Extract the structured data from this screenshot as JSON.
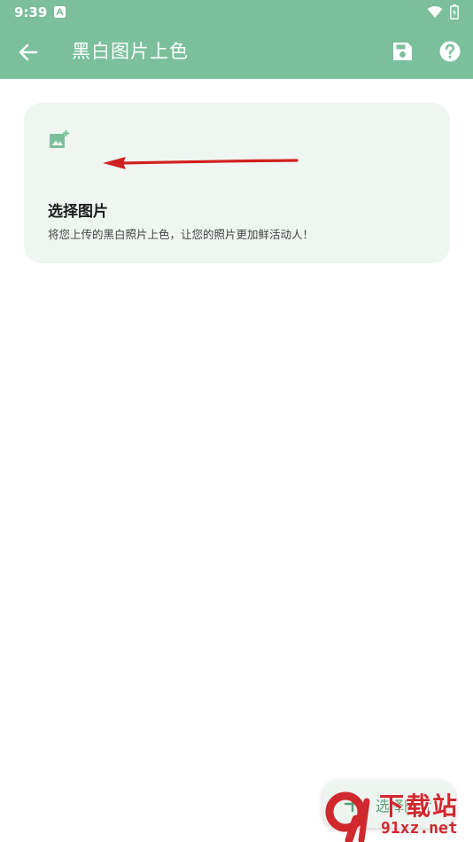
{
  "status_bar": {
    "time": "9:39"
  },
  "toolbar": {
    "title": "黑白图片上色"
  },
  "card": {
    "title": "选择图片",
    "description": "将您上传的黑白照片上色，让您的照片更加鲜活动人！"
  },
  "fab": {
    "label": "选择图片"
  },
  "watermark": {
    "brand": "下载站",
    "url": "91xz.net"
  },
  "colors": {
    "header": "#7bbf9b",
    "card_bg": "#eff6f1",
    "accent": "#5aa17a",
    "annotation_arrow": "#d12020"
  },
  "icons": [
    "back-arrow-icon",
    "save-icon",
    "help-icon",
    "add-photo-icon",
    "plus-icon",
    "wifi-icon",
    "battery-icon"
  ]
}
